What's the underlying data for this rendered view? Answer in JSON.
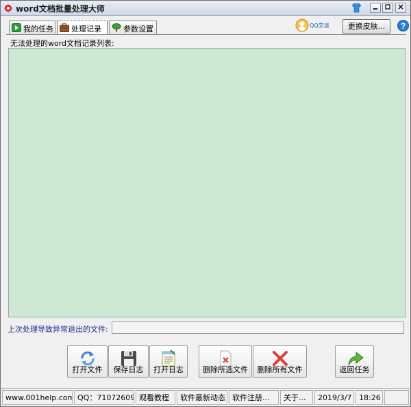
{
  "window": {
    "title": "word文档批量处理大师"
  },
  "tabs": [
    {
      "label": "我的任务",
      "icon": "play-icon"
    },
    {
      "label": "处理记录",
      "icon": "briefcase-icon"
    },
    {
      "label": "参数设置",
      "icon": "tree-icon"
    }
  ],
  "header": {
    "qq_label": "QQ交谈",
    "skin_label": "更换皮肤..."
  },
  "main": {
    "list_label": "无法处理的word文档记录列表:",
    "abnormal_label": "上次处理导致异常退出的文件:",
    "abnormal_value": ""
  },
  "actions": [
    {
      "label": "打开文件",
      "icon": "refresh-icon"
    },
    {
      "label": "保存日志",
      "icon": "floppy-icon"
    },
    {
      "label": "打开日志",
      "icon": "notepad-icon"
    },
    {
      "label": "删除所选文件",
      "icon": "delete-selected-icon"
    },
    {
      "label": "删除所有文件",
      "icon": "delete-all-icon"
    },
    {
      "label": "返回任务",
      "icon": "return-arrow-icon"
    }
  ],
  "statusbar": {
    "website": "www.001help.com",
    "qq": "QQ：71072609!",
    "tutorial": "观看教程",
    "news": "软件最新动态",
    "register": "软件注册...",
    "about": "关于...",
    "date": "2019/3/7",
    "time": "18:26"
  },
  "colors": {
    "list_bg": "#cfe8d3",
    "title_accent": "#d32020",
    "label_blue": "#1a2a8c"
  }
}
